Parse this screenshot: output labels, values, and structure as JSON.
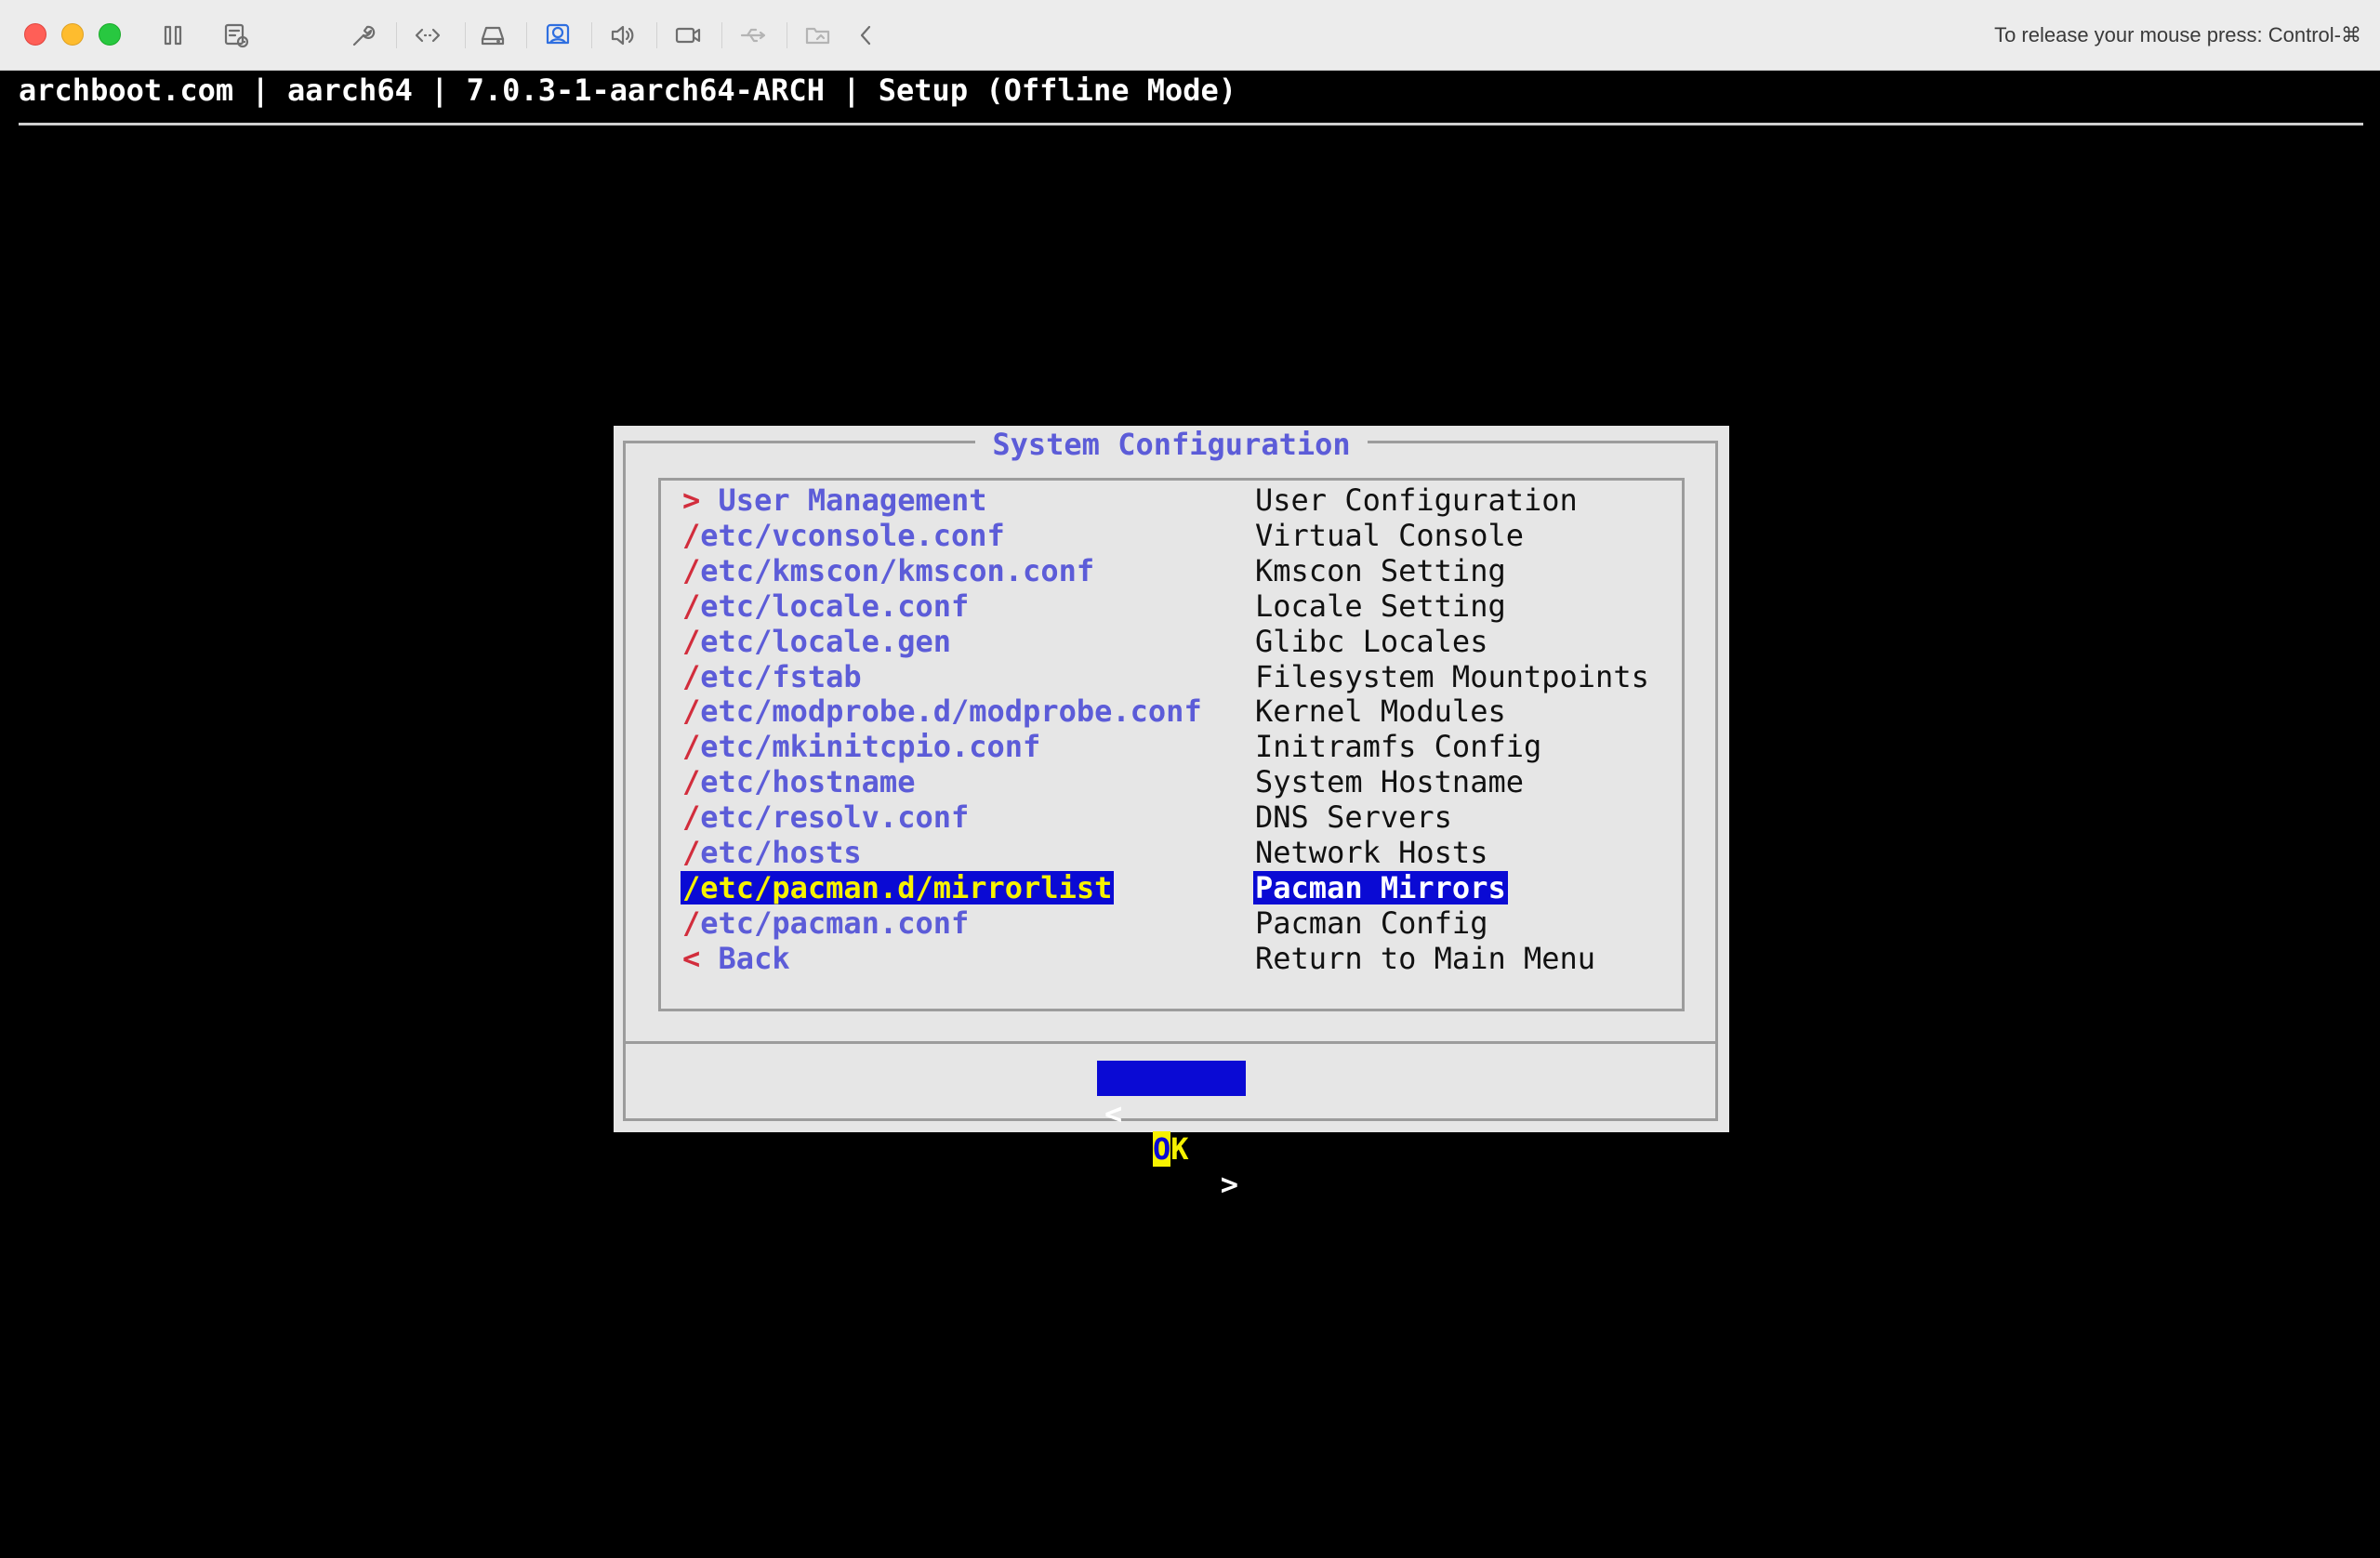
{
  "toolbar": {
    "release_hint": "To release your mouse press: Control-⌘",
    "icons": [
      "pause-icon",
      "snapshot-icon",
      "settings-wrench-icon",
      "code-icon",
      "disk-icon",
      "user-share-icon",
      "audio-icon",
      "camera-icon",
      "usb-icon",
      "shared-folder-icon",
      "chevron-left-icon"
    ]
  },
  "terminal": {
    "header": "archboot.com | aarch64 | 7.0.3-1-aarch64-ARCH | Setup (Offline Mode)"
  },
  "dialog": {
    "title": "System Configuration",
    "items": [
      {
        "lead": ">",
        "tag": " User Management",
        "desc": "User Configuration"
      },
      {
        "lead": "/",
        "tag": "etc/vconsole.conf",
        "desc": "Virtual Console"
      },
      {
        "lead": "/",
        "tag": "etc/kmscon/kmscon.conf",
        "desc": "Kmscon Setting"
      },
      {
        "lead": "/",
        "tag": "etc/locale.conf",
        "desc": "Locale Setting"
      },
      {
        "lead": "/",
        "tag": "etc/locale.gen",
        "desc": "Glibc Locales"
      },
      {
        "lead": "/",
        "tag": "etc/fstab",
        "desc": "Filesystem Mountpoints"
      },
      {
        "lead": "/",
        "tag": "etc/modprobe.d/modprobe.conf",
        "desc": "Kernel Modules"
      },
      {
        "lead": "/",
        "tag": "etc/mkinitcpio.conf",
        "desc": "Initramfs Config"
      },
      {
        "lead": "/",
        "tag": "etc/hostname",
        "desc": "System Hostname"
      },
      {
        "lead": "/",
        "tag": "etc/resolv.conf",
        "desc": "DNS Servers"
      },
      {
        "lead": "/",
        "tag": "etc/hosts",
        "desc": "Network Hosts"
      },
      {
        "lead": "/",
        "tag": "etc/pacman.d/mirrorlist",
        "desc": "Pacman Mirrors"
      },
      {
        "lead": "/",
        "tag": "etc/pacman.conf",
        "desc": "Pacman Config"
      },
      {
        "lead": "<",
        "tag": " Back",
        "desc": "Return to Main Menu"
      }
    ],
    "selected_index": 11,
    "ok_button": {
      "left": "<",
      "hotkey": "O",
      "rest": "K",
      "right": ">"
    }
  },
  "colors": {
    "terminal_bg": "#000000",
    "dialog_bg": "#e6e6e6",
    "tag_text": "#5c5cd8",
    "lead_char": "#d22d3c",
    "selection_bg": "#0a0ad4",
    "selection_text": "#f7f200"
  }
}
